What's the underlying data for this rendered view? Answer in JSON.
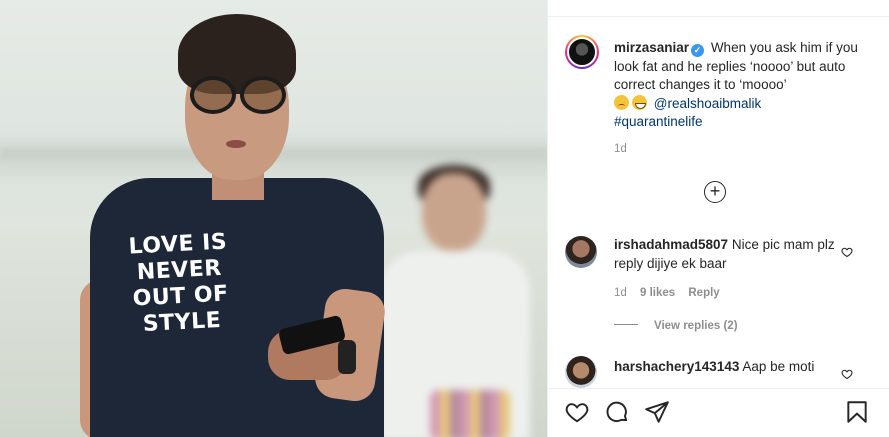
{
  "post": {
    "username": "mirzasaniar",
    "caption_text": "When you ask him if you look fat and he replies ‘noooo’ but auto correct changes it to ‘moooo’",
    "mention": "@realshoaibmalik",
    "hashtag": "#quarantinelife",
    "time": "1d",
    "shirt_line1": "LOVE IS NEVER",
    "shirt_line2": "OUT OF STYLE"
  },
  "comments": [
    {
      "username": "irshadahmad5807",
      "text": "Nice pic mam plz reply dijiye ek baar",
      "time": "1d",
      "likes": "9 likes",
      "reply": "Reply",
      "view_replies": "View replies (2)"
    },
    {
      "username": "harshachery143143",
      "text": "Aap be moti"
    }
  ],
  "icons": {
    "verified": "verified-badge-icon",
    "load_more": "plus-circle-icon",
    "like": "heart-icon",
    "comment": "comment-bubble-icon",
    "share": "paper-plane-icon",
    "save": "bookmark-icon"
  },
  "colors": {
    "link": "#00376b",
    "muted": "#8e8e8e",
    "verified": "#3897f0",
    "text": "#262626"
  }
}
